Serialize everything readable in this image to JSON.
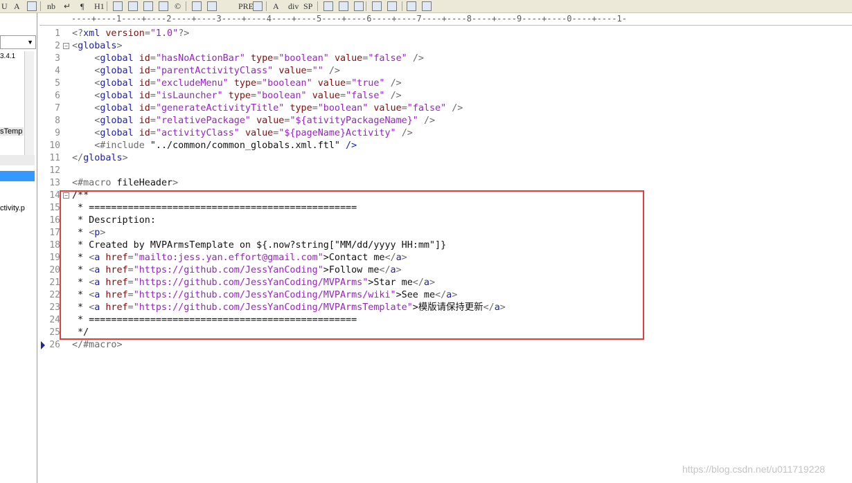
{
  "toolbar": {
    "buttons": [
      "U",
      "A",
      "grid-icon",
      "nb",
      "↵",
      "¶",
      "H1",
      "image-icon",
      "anchor-icon",
      "line-icon",
      "edit-icon",
      "©",
      "table-icon",
      "list-icon",
      "PRE",
      "list2-icon",
      "A",
      "div",
      "SP",
      "pen-icon",
      "brush-icon",
      "paint-icon",
      "doc-icon",
      "doc2-icon",
      "doc3-icon",
      "doc4-icon"
    ]
  },
  "left_panel": {
    "version": "3.4.1",
    "file1": "sTemp",
    "file2": "ctivity.p"
  },
  "ruler_text": "----+----1----+----2----+----3----+----4----+----5----+----6----+----7----+----8----+----9----+----0----+----1-",
  "lines": [
    {
      "n": "1",
      "segs": [
        [
          "t",
          "<?"
        ],
        [
          "tag",
          "xml "
        ],
        [
          "attr",
          "version"
        ],
        [
          "t",
          "="
        ],
        [
          "str",
          "\"1.0\""
        ],
        [
          "t",
          "?>"
        ]
      ]
    },
    {
      "n": "2",
      "fold": true,
      "segs": [
        [
          "t",
          "<"
        ],
        [
          "tag",
          "globals"
        ],
        [
          "t",
          ">"
        ]
      ]
    },
    {
      "n": "3",
      "segs": [
        [
          "plain",
          "    "
        ],
        [
          "t",
          "<"
        ],
        [
          "tag",
          "global "
        ],
        [
          "attr",
          "id"
        ],
        [
          "t",
          "="
        ],
        [
          "str",
          "\"hasNoActionBar\""
        ],
        [
          "plain",
          " "
        ],
        [
          "attr",
          "type"
        ],
        [
          "t",
          "="
        ],
        [
          "str",
          "\"boolean\""
        ],
        [
          "plain",
          " "
        ],
        [
          "attr",
          "value"
        ],
        [
          "t",
          "="
        ],
        [
          "str",
          "\"false\""
        ],
        [
          "plain",
          " "
        ],
        [
          "t",
          "/>"
        ]
      ]
    },
    {
      "n": "4",
      "segs": [
        [
          "plain",
          "    "
        ],
        [
          "t",
          "<"
        ],
        [
          "tag",
          "global "
        ],
        [
          "attr",
          "id"
        ],
        [
          "t",
          "="
        ],
        [
          "str",
          "\"parentActivityClass\""
        ],
        [
          "plain",
          " "
        ],
        [
          "attr",
          "value"
        ],
        [
          "t",
          "="
        ],
        [
          "str",
          "\"\""
        ],
        [
          "plain",
          " "
        ],
        [
          "t",
          "/>"
        ]
      ]
    },
    {
      "n": "5",
      "segs": [
        [
          "plain",
          "    "
        ],
        [
          "t",
          "<"
        ],
        [
          "tag",
          "global "
        ],
        [
          "attr",
          "id"
        ],
        [
          "t",
          "="
        ],
        [
          "str",
          "\"excludeMenu\""
        ],
        [
          "plain",
          " "
        ],
        [
          "attr",
          "type"
        ],
        [
          "t",
          "="
        ],
        [
          "str",
          "\"boolean\""
        ],
        [
          "plain",
          " "
        ],
        [
          "attr",
          "value"
        ],
        [
          "t",
          "="
        ],
        [
          "str",
          "\"true\""
        ],
        [
          "plain",
          " "
        ],
        [
          "t",
          "/>"
        ]
      ]
    },
    {
      "n": "6",
      "segs": [
        [
          "plain",
          "    "
        ],
        [
          "t",
          "<"
        ],
        [
          "tag",
          "global "
        ],
        [
          "attr",
          "id"
        ],
        [
          "t",
          "="
        ],
        [
          "str",
          "\"isLauncher\""
        ],
        [
          "plain",
          " "
        ],
        [
          "attr",
          "type"
        ],
        [
          "t",
          "="
        ],
        [
          "str",
          "\"boolean\""
        ],
        [
          "plain",
          " "
        ],
        [
          "attr",
          "value"
        ],
        [
          "t",
          "="
        ],
        [
          "str",
          "\"false\""
        ],
        [
          "plain",
          " "
        ],
        [
          "t",
          "/>"
        ]
      ]
    },
    {
      "n": "7",
      "segs": [
        [
          "plain",
          "    "
        ],
        [
          "t",
          "<"
        ],
        [
          "tag",
          "global "
        ],
        [
          "attr",
          "id"
        ],
        [
          "t",
          "="
        ],
        [
          "str",
          "\"generateActivityTitle\""
        ],
        [
          "plain",
          " "
        ],
        [
          "attr",
          "type"
        ],
        [
          "t",
          "="
        ],
        [
          "str",
          "\"boolean\""
        ],
        [
          "plain",
          " "
        ],
        [
          "attr",
          "value"
        ],
        [
          "t",
          "="
        ],
        [
          "str",
          "\"false\""
        ],
        [
          "plain",
          " "
        ],
        [
          "t",
          "/>"
        ]
      ]
    },
    {
      "n": "8",
      "segs": [
        [
          "plain",
          "    "
        ],
        [
          "t",
          "<"
        ],
        [
          "tag",
          "global "
        ],
        [
          "attr",
          "id"
        ],
        [
          "t",
          "="
        ],
        [
          "str",
          "\"relativePackage\""
        ],
        [
          "plain",
          " "
        ],
        [
          "attr",
          "value"
        ],
        [
          "t",
          "="
        ],
        [
          "str",
          "\"${ativityPackageName}\""
        ],
        [
          "plain",
          " "
        ],
        [
          "t",
          "/>"
        ]
      ]
    },
    {
      "n": "9",
      "segs": [
        [
          "plain",
          "    "
        ],
        [
          "t",
          "<"
        ],
        [
          "tag",
          "global "
        ],
        [
          "attr",
          "id"
        ],
        [
          "t",
          "="
        ],
        [
          "str",
          "\"activityClass\""
        ],
        [
          "plain",
          " "
        ],
        [
          "attr",
          "value"
        ],
        [
          "t",
          "="
        ],
        [
          "str",
          "\"${pageName}Activity\""
        ],
        [
          "plain",
          " "
        ],
        [
          "t",
          "/>"
        ]
      ]
    },
    {
      "n": "10",
      "segs": [
        [
          "plain",
          "    "
        ],
        [
          "ftl",
          "<#include "
        ],
        [
          "plain",
          "\"../common/common_globals.xml.ftl\""
        ],
        [
          "plain",
          " "
        ],
        [
          "tag",
          "/>"
        ]
      ]
    },
    {
      "n": "11",
      "segs": [
        [
          "t",
          "</"
        ],
        [
          "tag",
          "globals"
        ],
        [
          "t",
          ">"
        ]
      ]
    },
    {
      "n": "12",
      "segs": []
    },
    {
      "n": "13",
      "segs": [
        [
          "ftl",
          "<#macro "
        ],
        [
          "plain",
          "fileHeader"
        ],
        [
          "ftl",
          ">"
        ]
      ]
    },
    {
      "n": "14",
      "fold": true,
      "segs": [
        [
          "plain",
          "/**"
        ]
      ]
    },
    {
      "n": "15",
      "segs": [
        [
          "plain",
          " * ================================================"
        ]
      ]
    },
    {
      "n": "16",
      "segs": [
        [
          "plain",
          " * Description:"
        ]
      ]
    },
    {
      "n": "17",
      "segs": [
        [
          "plain",
          " * "
        ],
        [
          "t",
          "<"
        ],
        [
          "tag",
          "p"
        ],
        [
          "t",
          ">"
        ]
      ]
    },
    {
      "n": "18",
      "segs": [
        [
          "plain",
          " * Created by MVPArmsTemplate on ${.now?string[\"MM/dd/yyyy HH:mm\"]}"
        ]
      ]
    },
    {
      "n": "19",
      "segs": [
        [
          "plain",
          " * "
        ],
        [
          "t",
          "<"
        ],
        [
          "tag",
          "a "
        ],
        [
          "attr",
          "href"
        ],
        [
          "t",
          "="
        ],
        [
          "str",
          "\"mailto:jess.yan.effort@gmail.com\""
        ],
        [
          "plain",
          ">Contact me"
        ],
        [
          "t",
          "</"
        ],
        [
          "tag",
          "a"
        ],
        [
          "t",
          ">"
        ]
      ]
    },
    {
      "n": "20",
      "segs": [
        [
          "plain",
          " * "
        ],
        [
          "t",
          "<"
        ],
        [
          "tag",
          "a "
        ],
        [
          "attr",
          "href"
        ],
        [
          "t",
          "="
        ],
        [
          "str",
          "\"https://github.com/JessYanCoding\""
        ],
        [
          "plain",
          ">Follow me"
        ],
        [
          "t",
          "</"
        ],
        [
          "tag",
          "a"
        ],
        [
          "t",
          ">"
        ]
      ]
    },
    {
      "n": "21",
      "segs": [
        [
          "plain",
          " * "
        ],
        [
          "t",
          "<"
        ],
        [
          "tag",
          "a "
        ],
        [
          "attr",
          "href"
        ],
        [
          "t",
          "="
        ],
        [
          "str",
          "\"https://github.com/JessYanCoding/MVPArms\""
        ],
        [
          "plain",
          ">Star me"
        ],
        [
          "t",
          "</"
        ],
        [
          "tag",
          "a"
        ],
        [
          "t",
          ">"
        ]
      ]
    },
    {
      "n": "22",
      "segs": [
        [
          "plain",
          " * "
        ],
        [
          "t",
          "<"
        ],
        [
          "tag",
          "a "
        ],
        [
          "attr",
          "href"
        ],
        [
          "t",
          "="
        ],
        [
          "str",
          "\"https://github.com/JessYanCoding/MVPArms/wiki\""
        ],
        [
          "plain",
          ">See me"
        ],
        [
          "t",
          "</"
        ],
        [
          "tag",
          "a"
        ],
        [
          "t",
          ">"
        ]
      ]
    },
    {
      "n": "23",
      "segs": [
        [
          "plain",
          " * "
        ],
        [
          "t",
          "<"
        ],
        [
          "tag",
          "a "
        ],
        [
          "attr",
          "href"
        ],
        [
          "t",
          "="
        ],
        [
          "str",
          "\"https://github.com/JessYanCoding/MVPArmsTemplate\""
        ],
        [
          "plain",
          ">模版请保持更新"
        ],
        [
          "t",
          "</"
        ],
        [
          "tag",
          "a"
        ],
        [
          "t",
          ">"
        ]
      ]
    },
    {
      "n": "24",
      "segs": [
        [
          "plain",
          " * ================================================"
        ]
      ]
    },
    {
      "n": "25",
      "segs": [
        [
          "plain",
          " */"
        ]
      ]
    },
    {
      "n": "26",
      "current": true,
      "segs": [
        [
          "t",
          "</"
        ],
        [
          "ftl",
          "#macro"
        ],
        [
          "t",
          ">"
        ]
      ]
    }
  ],
  "watermark": "https://blog.csdn.net/u011719228"
}
